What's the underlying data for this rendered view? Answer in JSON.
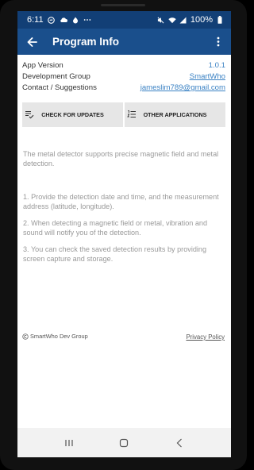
{
  "status": {
    "time": "6:11",
    "battery": "100%",
    "left_icons": [
      "messenger-icon",
      "cloud-icon",
      "app-icon",
      "more-dots-icon"
    ],
    "right_icons": [
      "mute-icon",
      "wifi-icon",
      "signal-icon",
      "battery-icon"
    ]
  },
  "app_bar": {
    "title": "Program Info",
    "back_icon": "arrow-back-icon",
    "menu_icon": "more-vert-icon",
    "color": "#1a4f8c"
  },
  "info": [
    {
      "label": "App Version",
      "value": "1.0.1"
    },
    {
      "label": "Development Group",
      "value": "SmartWho"
    },
    {
      "label": "Contact / Suggestions",
      "value": "jameslim789@gmail.com"
    }
  ],
  "buttons": {
    "check_updates": "CHECK FOR UPDATES",
    "other_apps": "OTHER APPLICATIONS"
  },
  "description": {
    "intro": "The metal detector supports precise magnetic field and metal detection.",
    "item1": "1. Provide the detection date and time, and the measurement address (latitude, longitude).",
    "item2": "2. When detecting a magnetic field or metal, vibration and sound will notify you of the detection.",
    "item3": "3. You can check the saved detection results by providing screen capture and storage."
  },
  "footer": {
    "copyright": "SmartWho Dev Group",
    "privacy": "Privacy Policy"
  },
  "nav": {
    "recents": "recents-icon",
    "home": "home-icon",
    "back": "back-icon"
  }
}
